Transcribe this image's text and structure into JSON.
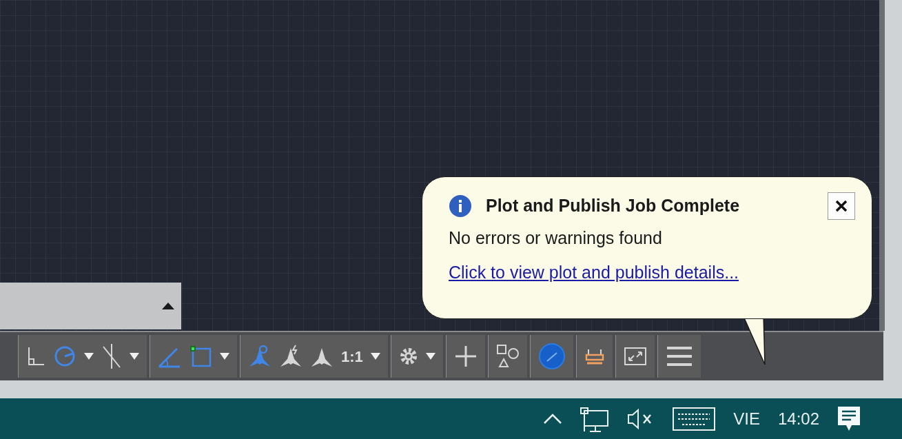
{
  "notification": {
    "title": "Plot and Publish Job Complete",
    "message": "No errors or warnings found",
    "link": "Click to view plot and publish details..."
  },
  "status_bar": {
    "groups": [
      {
        "items": [
          {
            "kind": "ortho",
            "on": false
          },
          {
            "kind": "polar",
            "on": true
          },
          {
            "kind": "caret"
          },
          {
            "kind": "isodraft",
            "on": false
          },
          {
            "kind": "caret"
          }
        ]
      },
      {
        "items": [
          {
            "kind": "angle",
            "on": true
          },
          {
            "kind": "osnap",
            "on": true
          },
          {
            "kind": "caret"
          }
        ]
      },
      {
        "items": [
          {
            "kind": "figure",
            "on": true
          },
          {
            "kind": "figurebolt",
            "on": false
          },
          {
            "kind": "figureplain",
            "on": false
          },
          {
            "kind": "text",
            "label": "1:1"
          },
          {
            "kind": "caret"
          }
        ]
      },
      {
        "items": [
          {
            "kind": "gear",
            "on": false
          },
          {
            "kind": "caret"
          }
        ]
      },
      {
        "items": [
          {
            "kind": "plus",
            "on": false
          }
        ]
      },
      {
        "items": [
          {
            "kind": "shapes",
            "on": false
          }
        ]
      },
      {
        "items": [
          {
            "kind": "isolate",
            "on": true
          }
        ]
      },
      {
        "items": [
          {
            "kind": "tray",
            "on": false
          }
        ]
      },
      {
        "items": [
          {
            "kind": "fullscreen",
            "on": false
          }
        ]
      },
      {
        "items": [
          {
            "kind": "menu",
            "on": false
          }
        ]
      }
    ]
  },
  "taskbar": {
    "language": "VIE",
    "time": "14:02"
  }
}
